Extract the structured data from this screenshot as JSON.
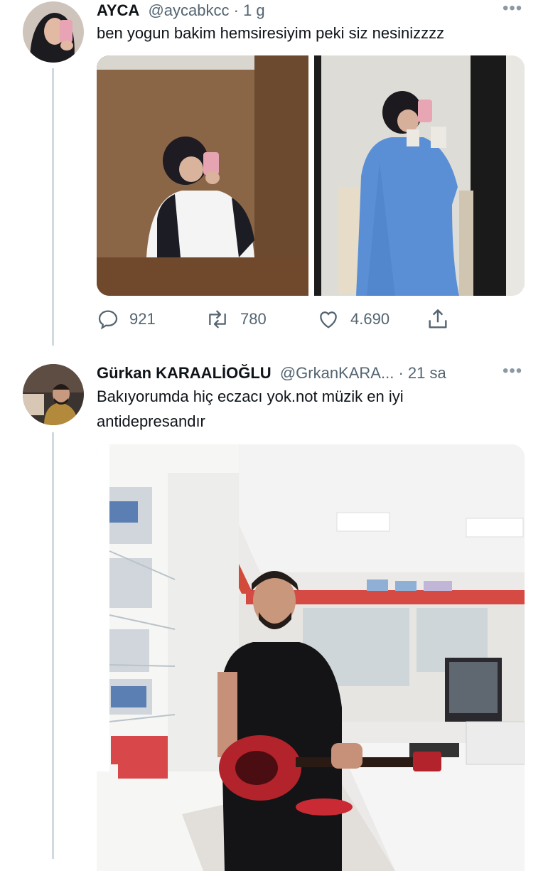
{
  "tweet1": {
    "name": "AYCA",
    "handle": "@aycabkcc",
    "time": "· 1 g",
    "text": "ben yogun bakim hemsiresiyim peki siz nesinizzzz",
    "replies": "921",
    "retweets": "780",
    "likes": "4.690"
  },
  "tweet2": {
    "name": "Gürkan KARAALİOĞLU",
    "handle": "@GrkanKARA...",
    "time": "· 21 sa",
    "text_line1": "Bakıyorumda hiç eczacı yok.not müzik en iyi",
    "text_line2": "antidepresandır"
  },
  "icons": [
    "reply-icon",
    "retweet-icon",
    "like-icon",
    "share-icon",
    "more-icon"
  ],
  "colors": {
    "text": "#0f1419",
    "secondary": "#536471",
    "thread": "#cfd9de"
  }
}
